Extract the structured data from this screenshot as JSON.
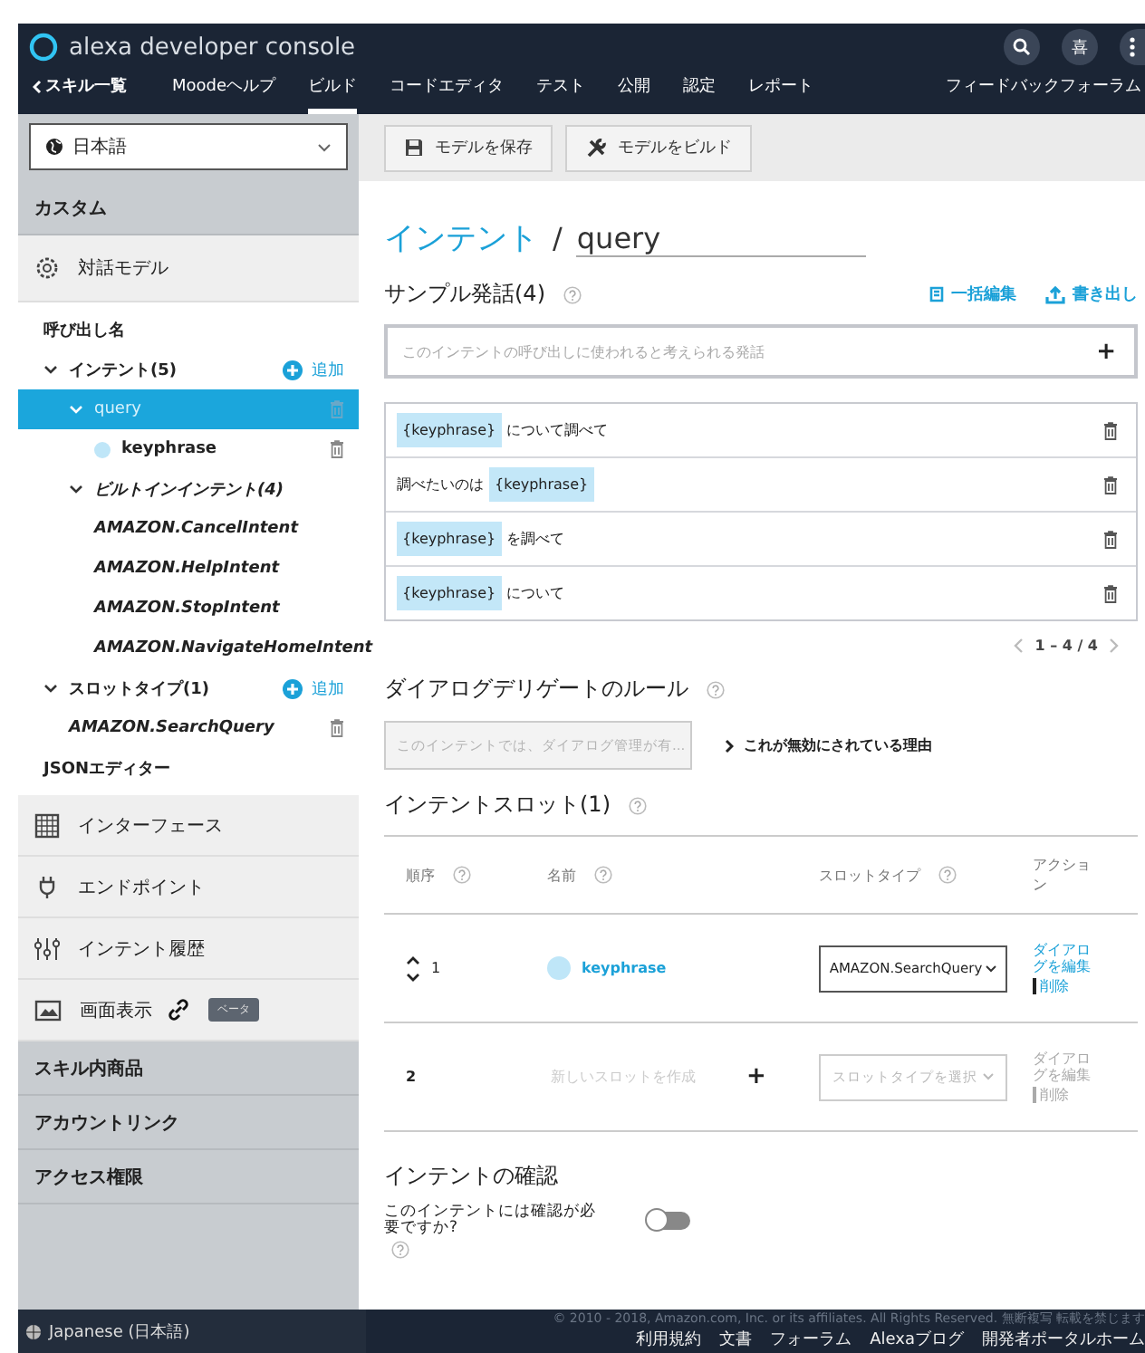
{
  "header": {
    "logo_text": "alexa developer console",
    "avatar": "喜",
    "nav": [
      {
        "label": "スキル一覧",
        "kind": "back",
        "selected": false
      },
      {
        "label": "Moodeヘルプ",
        "kind": "tab",
        "selected": false
      },
      {
        "label": "ビルド",
        "kind": "tab",
        "selected": true
      },
      {
        "label": "コードエディタ",
        "kind": "tab",
        "selected": false
      },
      {
        "label": "テスト",
        "kind": "tab",
        "selected": false
      },
      {
        "label": "公開",
        "kind": "tab",
        "selected": false
      },
      {
        "label": "認定",
        "kind": "tab",
        "selected": false
      },
      {
        "label": "レポート",
        "kind": "tab",
        "selected": false
      }
    ],
    "feedback": "フィードバックフォーラム"
  },
  "sidebar": {
    "locale": "日本語",
    "blocks": [
      {
        "kind": "section",
        "label": "カスタム"
      },
      {
        "kind": "panel",
        "label": "対話モデル",
        "selected": true
      },
      {
        "kind": "tree"
      },
      {
        "kind": "panel",
        "label": "インターフェース",
        "selected": false
      },
      {
        "kind": "panel",
        "label": "エンドポイント",
        "selected": false
      },
      {
        "kind": "panel",
        "label": "インテント履歴",
        "selected": false
      },
      {
        "kind": "panel",
        "label": "画面表示",
        "selected": false,
        "badge": "ベータ"
      },
      {
        "kind": "section",
        "label": "スキル内商品"
      },
      {
        "kind": "section",
        "label": "アカウントリンク"
      },
      {
        "kind": "section",
        "label": "アクセス権限"
      }
    ],
    "tree": [
      {
        "label": "呼び出し名",
        "selected": false
      },
      {
        "label": "インテント(5)",
        "selected": false,
        "expanded": true,
        "add_label": "追加",
        "children": [
          {
            "label": "query",
            "selected": true,
            "expanded": true,
            "deletable": true,
            "children": [
              {
                "label": "keyphrase",
                "kind": "slot",
                "selected": false,
                "deletable": true
              }
            ]
          },
          {
            "label": "ビルトインインテント(4)",
            "kind": "builtin",
            "selected": false,
            "expanded": true,
            "children": [
              {
                "label": "AMAZON.CancelIntent",
                "kind": "builtin",
                "selected": false
              },
              {
                "label": "AMAZON.HelpIntent",
                "kind": "builtin",
                "selected": false
              },
              {
                "label": "AMAZON.StopIntent",
                "kind": "builtin",
                "selected": false
              },
              {
                "label": "AMAZON.NavigateHomeIntent",
                "kind": "builtin",
                "selected": false
              }
            ]
          }
        ]
      },
      {
        "label": "スロットタイプ(1)",
        "selected": false,
        "expanded": true,
        "add_label": "追加",
        "children": [
          {
            "label": "AMAZON.SearchQuery",
            "kind": "builtin",
            "selected": false,
            "deletable": true
          }
        ]
      },
      {
        "label": "JSONエディター",
        "selected": false
      }
    ]
  },
  "toolbar": {
    "buttons": [
      "モデルを保存",
      "モデルをビルド"
    ]
  },
  "intent": {
    "section": "インテント",
    "separator": "/",
    "name": "query"
  },
  "utterances": {
    "title": "サンプル発話(4)",
    "actions": [
      "一括編集",
      "書き出し"
    ],
    "placeholder": "このインテントの呼び出しに使われると考えられる発話",
    "add": "+",
    "rows": [
      {
        "parts": [
          {
            "kind": "slot",
            "text": "{keyphrase}"
          },
          {
            "kind": "text",
            "text": "について調べて"
          }
        ]
      },
      {
        "parts": [
          {
            "kind": "text",
            "text": "調べたいのは"
          },
          {
            "kind": "slot",
            "text": "{keyphrase}"
          }
        ]
      },
      {
        "parts": [
          {
            "kind": "slot",
            "text": "{keyphrase}"
          },
          {
            "kind": "text",
            "text": "を調べて"
          }
        ]
      },
      {
        "parts": [
          {
            "kind": "slot",
            "text": "{keyphrase}"
          },
          {
            "kind": "text",
            "text": "について"
          }
        ]
      }
    ],
    "pager": "1 – 4 / 4"
  },
  "delegate": {
    "title": "ダイアログデリゲートのルール",
    "value": "このインテントでは、ダイアログ管理が有...",
    "disabled": true,
    "link": "これが無効にされている理由"
  },
  "slots": {
    "title": "インテントスロット(1)",
    "columns": [
      "順序",
      "名前",
      "スロットタイプ",
      "アクション"
    ],
    "rows": [
      {
        "kind": "existing",
        "order": "1",
        "name": "keyphrase",
        "type": "AMAZON.SearchQuery",
        "actions": [
          "ダイアログを編集",
          "削除"
        ]
      },
      {
        "kind": "new",
        "order": "2",
        "placeholder": "新しいスロットを作成",
        "add": "+",
        "type_placeholder": "スロットタイプを選択",
        "actions": [
          "ダイアログを編集",
          "削除"
        ]
      }
    ]
  },
  "confirm": {
    "title": "インテントの確認",
    "question": "このインテントには確認が必要ですか?",
    "on": false
  },
  "footer": {
    "locale": "Japanese (日本語)",
    "copyright": "© 2010 - 2018, Amazon.com, Inc. or its affiliates. All Rights Reserved. 無断複写 転載を禁じます",
    "links": [
      "利用規約",
      "文書",
      "フォーラム",
      "Alexaブログ",
      "開発者ポータルホーム"
    ]
  }
}
